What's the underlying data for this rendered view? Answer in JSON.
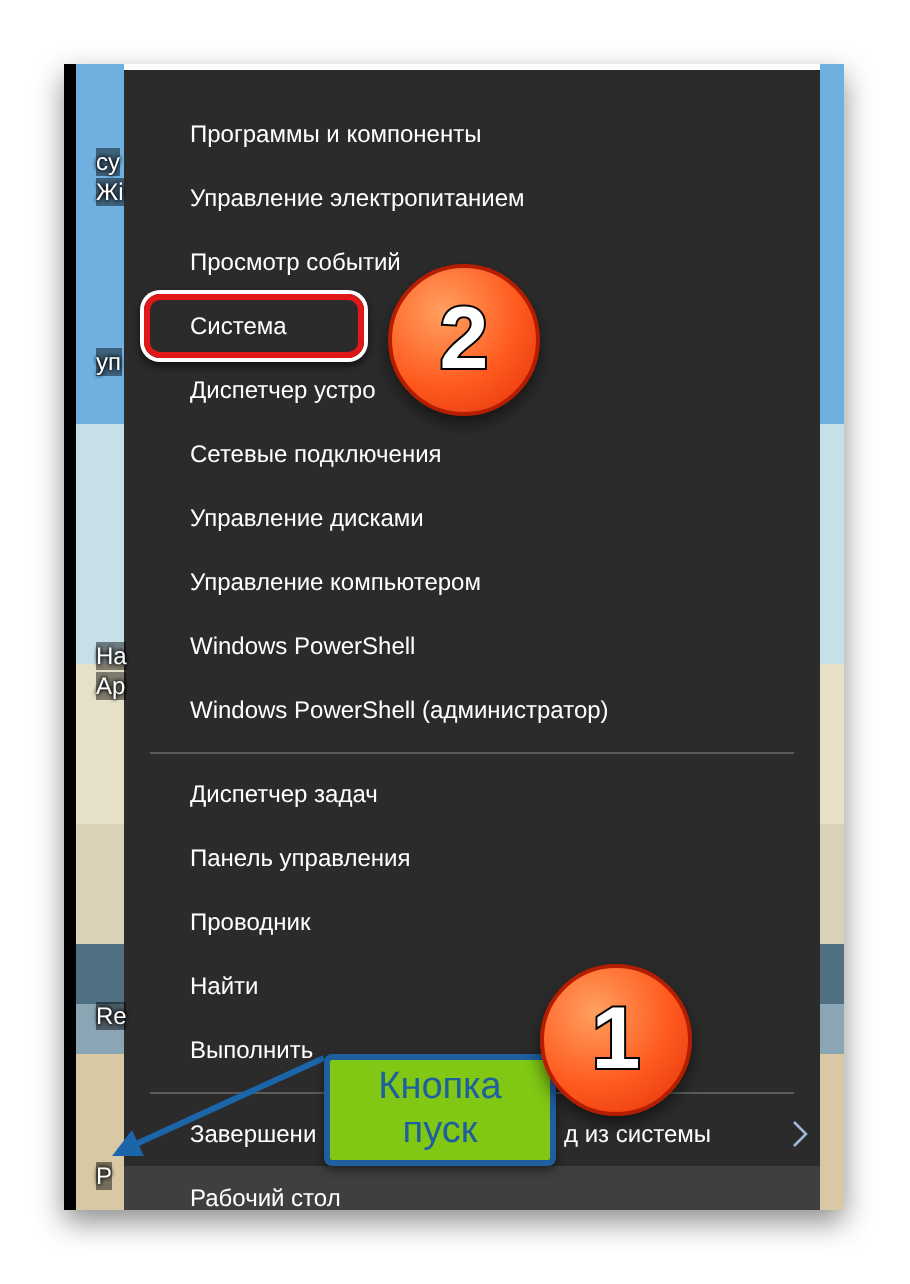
{
  "desktop": {
    "labels": [
      "су",
      "Жі",
      "уп",
      "На",
      "Ар",
      "Re",
      "Р"
    ]
  },
  "menu": {
    "sections": [
      {
        "items": [
          {
            "label": "Программы и компоненты",
            "selected": false,
            "highlighted": false,
            "submenu": false
          },
          {
            "label": "Управление электропитанием",
            "selected": false,
            "highlighted": false,
            "submenu": false
          },
          {
            "label": "Просмотр событий",
            "selected": false,
            "highlighted": false,
            "submenu": false
          },
          {
            "label": "Система",
            "selected": false,
            "highlighted": true,
            "submenu": false
          },
          {
            "label": "Диспетчер устро",
            "selected": false,
            "highlighted": false,
            "submenu": false
          },
          {
            "label": "Сетевые подключения",
            "selected": false,
            "highlighted": false,
            "submenu": false
          },
          {
            "label": "Управление дисками",
            "selected": false,
            "highlighted": false,
            "submenu": false
          },
          {
            "label": "Управление компьютером",
            "selected": false,
            "highlighted": false,
            "submenu": false
          },
          {
            "label": "Windows PowerShell",
            "selected": false,
            "highlighted": false,
            "submenu": false
          },
          {
            "label": "Windows PowerShell (администратор)",
            "selected": false,
            "highlighted": false,
            "submenu": false
          }
        ]
      },
      {
        "items": [
          {
            "label": "Диспетчер задач",
            "selected": false,
            "highlighted": false,
            "submenu": false
          },
          {
            "label": "Панель управления",
            "selected": false,
            "highlighted": false,
            "submenu": false
          },
          {
            "label": "Проводник",
            "selected": false,
            "highlighted": false,
            "submenu": false
          },
          {
            "label": "Найти",
            "selected": false,
            "highlighted": false,
            "submenu": false
          },
          {
            "label": "Выполнить",
            "selected": false,
            "highlighted": false,
            "submenu": false
          }
        ]
      },
      {
        "items": [
          {
            "label": "Завершени",
            "label_end": "д из системы",
            "selected": false,
            "highlighted": false,
            "submenu": true
          },
          {
            "label": "Рабочий стол",
            "selected": true,
            "highlighted": false,
            "submenu": false
          }
        ]
      }
    ]
  },
  "annotations": {
    "badges": [
      {
        "text": "2"
      },
      {
        "text": "1"
      }
    ],
    "callout": {
      "text": "Кнопка пуск"
    }
  }
}
